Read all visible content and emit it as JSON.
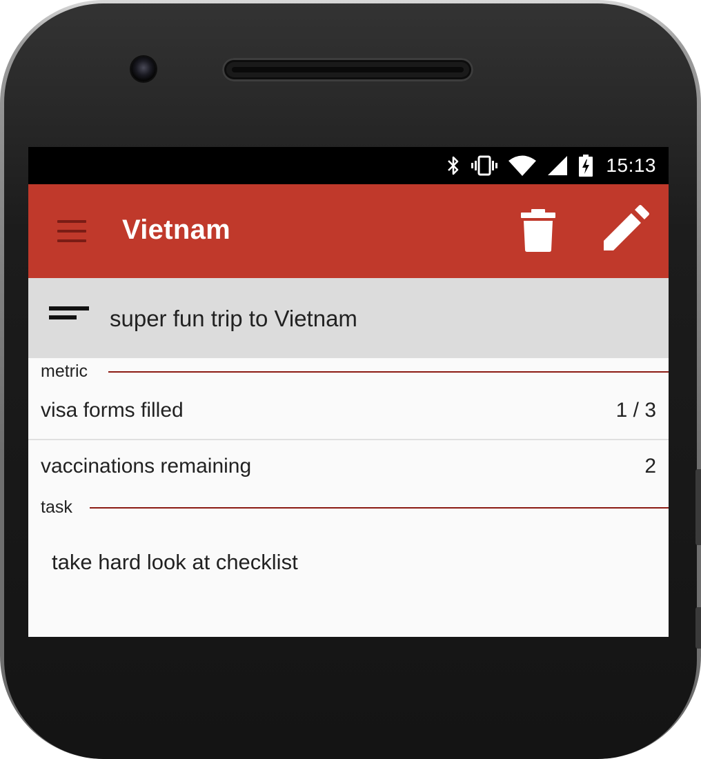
{
  "status_bar": {
    "time": "15:13",
    "icons": [
      "bluetooth-icon",
      "vibrate-icon",
      "wifi-icon",
      "signal-icon",
      "battery-charging-icon"
    ]
  },
  "app_bar": {
    "title": "Vietnam",
    "background_color": "#c0392b",
    "menu_icon": "hamburger-menu-icon",
    "actions": [
      "delete-icon",
      "edit-pencil-icon"
    ]
  },
  "description": {
    "icon": "short-text-icon",
    "text": "super fun trip to Vietnam"
  },
  "sections": {
    "metric": {
      "label": "metric",
      "items": [
        {
          "label": "visa forms filled",
          "value": "1 / 3"
        },
        {
          "label": "vaccinations remaining",
          "value": "2"
        }
      ]
    },
    "task": {
      "label": "task",
      "items": [
        {
          "label": "take hard look at checklist"
        }
      ]
    }
  }
}
